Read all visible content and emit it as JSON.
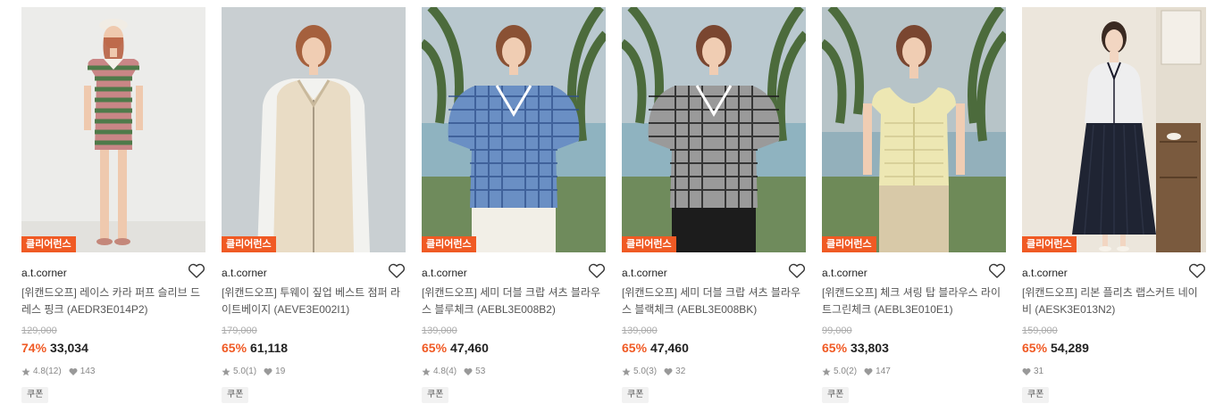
{
  "colors": {
    "badge": "#f05a24",
    "discount": "#f05a24",
    "strike": "#aaaaaa"
  },
  "products": [
    {
      "badge": "클리어런스",
      "brand": "a.t.corner",
      "name": "[위캔드오프] 레이스 카라 퍼프 슬리브 드레스 핑크 (AEDR3E014P2)",
      "original_price": "129,000",
      "discount": "74%",
      "price": "33,034",
      "rating": "4.8",
      "reviews": "(12)",
      "likes": "143",
      "coupon": "쿠폰",
      "image": "woman in pink and green striped puff sleeve dress with beret"
    },
    {
      "badge": "클리어런스",
      "brand": "a.t.corner",
      "name": "[위캔드오프] 투웨이 짚업 베스트 점퍼 라이트베이지 (AEVE3E002I1)",
      "original_price": "179,000",
      "discount": "65%",
      "price": "61,118",
      "rating": "5.0",
      "reviews": "(1)",
      "likes": "19",
      "coupon": "쿠폰",
      "image": "woman in light beige zip-up vest over white shirt"
    },
    {
      "badge": "클리어런스",
      "brand": "a.t.corner",
      "name": "[위캔드오프] 세미 더블 크랍 셔츠 블라우스 블루체크 (AEBL3E008B2)",
      "original_price": "139,000",
      "discount": "65%",
      "price": "47,460",
      "rating": "4.8",
      "reviews": "(4)",
      "likes": "53",
      "coupon": "쿠폰",
      "image": "woman in blue check cropped blouse with palm trees"
    },
    {
      "badge": "클리어런스",
      "brand": "a.t.corner",
      "name": "[위캔드오프] 세미 더블 크랍 셔츠 블라우스 블랙체크 (AEBL3E008BK)",
      "original_price": "139,000",
      "discount": "65%",
      "price": "47,460",
      "rating": "5.0",
      "reviews": "(3)",
      "likes": "32",
      "coupon": "쿠폰",
      "image": "woman in black check cropped blouse with palm trees"
    },
    {
      "badge": "클리어런스",
      "brand": "a.t.corner",
      "name": "[위캔드오프] 체크 셔링 탑 블라우스 라이트그린체크 (AEBL3E010E1)",
      "original_price": "99,000",
      "discount": "65%",
      "price": "33,803",
      "rating": "5.0",
      "reviews": "(2)",
      "likes": "147",
      "coupon": "쿠폰",
      "image": "woman in light yellow-green check shirring top"
    },
    {
      "badge": "클리어런스",
      "brand": "a.t.corner",
      "name": "[위캔드오프] 리본 플리츠 랩스커트 네이비 (AESK3E013N2)",
      "original_price": "159,000",
      "discount": "65%",
      "price": "54,289",
      "rating": "",
      "reviews": "",
      "likes": "31",
      "coupon": "쿠폰",
      "image": "woman in white tweed jacket and navy pleated skirt indoors"
    }
  ]
}
